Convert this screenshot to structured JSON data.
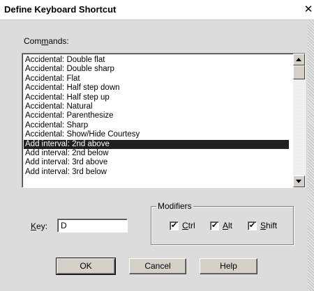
{
  "window": {
    "title": "Define Keyboard Shortcut",
    "close_glyph": "✕"
  },
  "commands": {
    "label_prefix": "Com",
    "label_accel": "m",
    "label_suffix": "ands:",
    "items": [
      "Accidental: Double flat",
      "Accidental: Double sharp",
      "Accidental: Flat",
      "Accidental: Half step down",
      "Accidental: Half step up",
      "Accidental: Natural",
      "Accidental: Parenthesize",
      "Accidental: Sharp",
      "Accidental: Show/Hide Courtesy",
      "Add interval: 2nd above",
      "Add interval: 2nd below",
      "Add interval: 3rd above",
      "Add interval: 3rd below"
    ],
    "selected_index": 9
  },
  "key": {
    "label_accel": "K",
    "label_suffix": "ey:",
    "value": "D"
  },
  "modifiers": {
    "title": "Modifiers",
    "ctrl": {
      "accel": "C",
      "rest": "trl",
      "checked": true
    },
    "alt": {
      "accel": "A",
      "rest": "lt",
      "checked": true
    },
    "shift": {
      "accel": "S",
      "rest": "hift",
      "checked": true
    }
  },
  "buttons": {
    "ok": "OK",
    "cancel": "Cancel",
    "help": "Help"
  },
  "check_glyph": "✔"
}
